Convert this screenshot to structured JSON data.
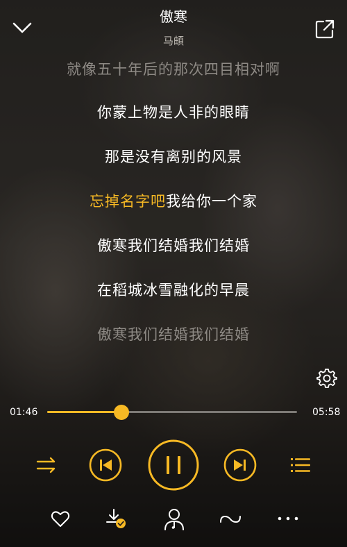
{
  "song": {
    "title": "傲寒",
    "artist": "马頔"
  },
  "lyrics": {
    "lines": [
      {
        "text": "就像五十年后的那次四目相对啊",
        "style": "dim"
      },
      {
        "text": "你蒙上物是人非的眼睛",
        "style": "normal"
      },
      {
        "text": "那是没有离别的风景",
        "style": "normal"
      },
      {
        "text": "我给你一个家",
        "style": "active",
        "highlight": "忘掉名字吧"
      },
      {
        "text": "傲寒我们结婚我们结婚",
        "style": "normal"
      },
      {
        "text": "在稻城冰雪融化的早晨",
        "style": "normal"
      },
      {
        "text": "傲寒我们结婚我们结婚",
        "style": "dim"
      }
    ]
  },
  "progress": {
    "current_time": "01:46",
    "total_time": "05:58",
    "fraction": 0.296
  },
  "colors": {
    "accent": "#f7b924",
    "text": "#ffffff",
    "dim_text": "#8e8a85",
    "track": "#7d7a76"
  },
  "icons": {
    "top_left": "chevron-down-icon",
    "top_right": "share-icon",
    "settings": "gear-icon",
    "controls": [
      "shuffle-icon",
      "previous-icon",
      "pause-icon",
      "next-icon",
      "playlist-icon"
    ],
    "bottom": [
      "heart-icon",
      "downloaded-icon",
      "singer-icon",
      "loop-icon",
      "more-icon"
    ]
  }
}
